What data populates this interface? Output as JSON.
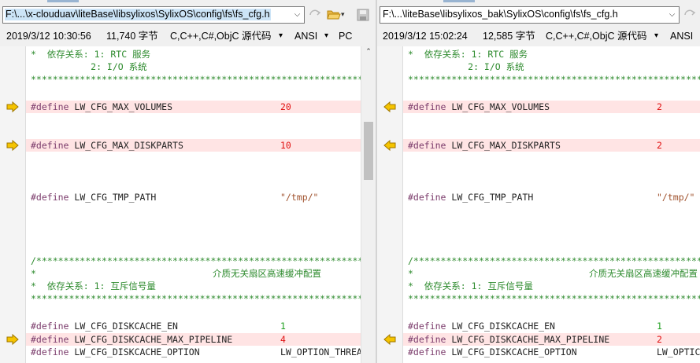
{
  "left": {
    "path": "F:\\...\\x-clouduav\\liteBase\\libsylixos\\SylixOS\\config\\fs\\fs_cfg.h",
    "info": {
      "datetime": "2019/3/12 10:30:56",
      "size": "11,740 字节",
      "lang": "C,C++,C#,ObjC 源代码",
      "encoding": "ANSI",
      "lineend": "PC"
    }
  },
  "right": {
    "path": "F:\\...\\liteBase\\libsylixos_bak\\SylixOS\\config\\fs\\fs_cfg.h",
    "info": {
      "datetime": "2019/3/12 15:02:24",
      "size": "12,585 字节",
      "lang": "C,C++,C#,ObjC 源代码",
      "encoding": "ANSI"
    }
  },
  "colors": {
    "diff_background": "#ffe4e4",
    "diff_value": "#e01010",
    "arrow": "#e8b400",
    "selection": "#cce4f7"
  },
  "icons": [
    "dropdown-icon",
    "sync-icon",
    "open-folder-icon",
    "save-icon",
    "diff-arrow-right-icon",
    "diff-arrow-left-icon",
    "scroll-up-icon"
  ],
  "dropdown_glyph": "⌵",
  "info_dropdown_glyph": "▾",
  "scroll_up_glyph": "⌃",
  "code": {
    "comment_dep_header": "*  依存关系: 1: RTC 服务",
    "comment_dep_io": "           2: I/O 系统",
    "stars": "*********************************************************************************************************",
    "slash_stars": "/*********************************************************************************************************",
    "star_only": "*",
    "media_title": "介质无关扇区高速缓冲配置",
    "comment_dep_mutex": "*  依存关系: 1: 互斥信号量",
    "define": "#define",
    "max_volumes": "LW_CFG_MAX_VOLUMES",
    "max_diskparts": "LW_CFG_MAX_DISKPARTS",
    "tmp_path": "LW_CFG_TMP_PATH",
    "tmp_path_val": "\"/tmp/\"",
    "diskcache_en": "LW_CFG_DISKCACHE_EN",
    "diskcache_en_val": "1",
    "diskcache_pipeline": "LW_CFG_DISKCACHE_MAX_PIPELINE",
    "diskcache_option": "LW_CFG_DISKCACHE_OPTION",
    "left_max_volumes_val": "20",
    "left_max_diskparts_val": "10",
    "left_pipeline_val": "4",
    "left_option_val": "LW_OPTION_THREA",
    "right_max_volumes_val": "2",
    "right_max_diskparts_val": "2",
    "right_pipeline_val": "2",
    "right_option_val": "LW_OPTIC"
  }
}
